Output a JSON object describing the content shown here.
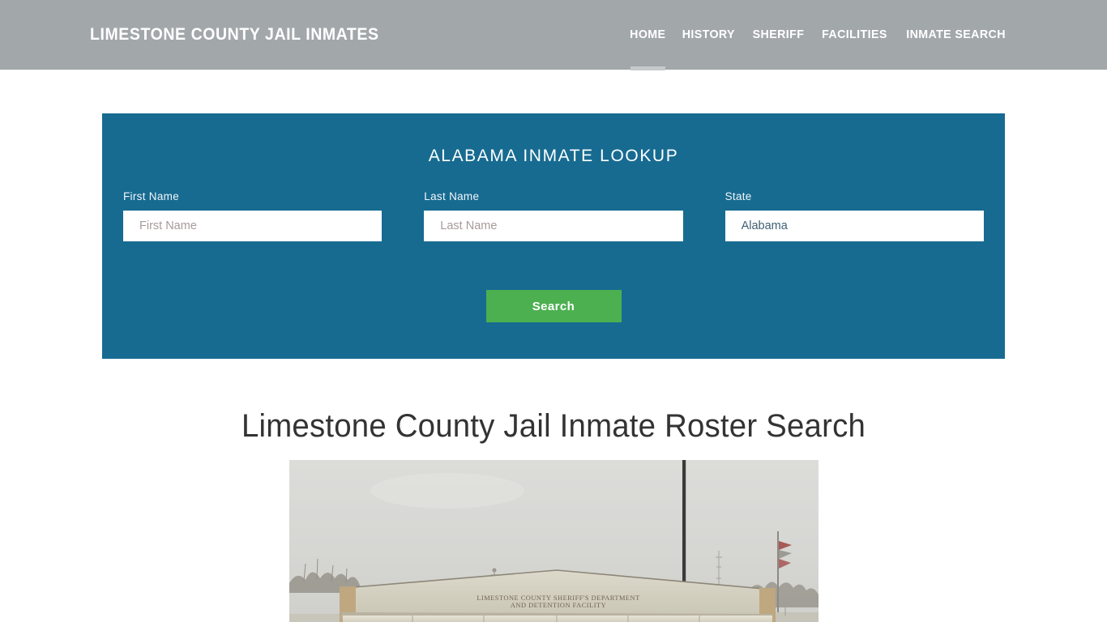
{
  "header": {
    "brand": "LIMESTONE COUNTY JAIL INMATES",
    "nav": [
      {
        "label": "HOME",
        "active": true
      },
      {
        "label": "HISTORY",
        "active": false
      },
      {
        "label": "SHERIFF",
        "active": false
      },
      {
        "label": "FACILITIES",
        "active": false
      },
      {
        "label": "INMATE SEARCH",
        "active": false
      }
    ],
    "bg_color": "#a2a7aa",
    "active_indicator_color": "#c6cacc"
  },
  "lookup": {
    "title": "ALABAMA INMATE LOOKUP",
    "panel_color": "#176b91",
    "first_name": {
      "label": "First Name",
      "placeholder": "First Name",
      "value": ""
    },
    "last_name": {
      "label": "Last Name",
      "placeholder": "Last Name",
      "value": ""
    },
    "state": {
      "label": "State",
      "selected": "Alabama",
      "options": [
        "Alabama"
      ]
    },
    "search_button": {
      "label": "Search",
      "color": "#4cb050"
    }
  },
  "content": {
    "heading": "Limestone County Jail Inmate Roster Search",
    "photo": {
      "alt": "Limestone County Sheriff's Department and Detention Facility building exterior",
      "sign_line_1": "LIMESTONE COUNTY SHERIFF'S DEPARTMENT",
      "sign_line_2": "AND DETENTION FACILITY"
    }
  }
}
